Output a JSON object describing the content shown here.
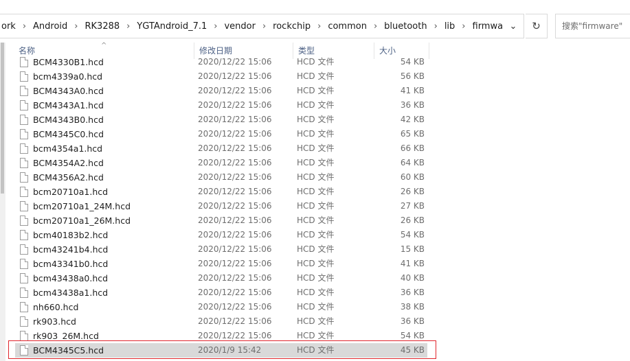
{
  "address": {
    "crumbs": [
      "ork",
      "Android",
      "RK3288",
      "YGTAndroid_7.1",
      "vendor",
      "rockchip",
      "common",
      "bluetooth",
      "lib",
      "firmware"
    ],
    "separator": "›",
    "dropdown_glyph": "⌄",
    "refresh_glyph": "↻"
  },
  "search": {
    "placeholder": "搜索\"firmware\""
  },
  "columns": {
    "name": "名称",
    "date": "修改日期",
    "type": "类型",
    "size": "大小",
    "sort_glyph": "^"
  },
  "files": [
    {
      "name": "BCM4330B1.hcd",
      "date": "2020/12/22 15:06",
      "type": "HCD 文件",
      "size": "54 KB"
    },
    {
      "name": "bcm4339a0.hcd",
      "date": "2020/12/22 15:06",
      "type": "HCD 文件",
      "size": "56 KB"
    },
    {
      "name": "BCM4343A0.hcd",
      "date": "2020/12/22 15:06",
      "type": "HCD 文件",
      "size": "41 KB"
    },
    {
      "name": "BCM4343A1.hcd",
      "date": "2020/12/22 15:06",
      "type": "HCD 文件",
      "size": "36 KB"
    },
    {
      "name": "BCM4343B0.hcd",
      "date": "2020/12/22 15:06",
      "type": "HCD 文件",
      "size": "42 KB"
    },
    {
      "name": "BCM4345C0.hcd",
      "date": "2020/12/22 15:06",
      "type": "HCD 文件",
      "size": "65 KB"
    },
    {
      "name": "bcm4354a1.hcd",
      "date": "2020/12/22 15:06",
      "type": "HCD 文件",
      "size": "66 KB"
    },
    {
      "name": "BCM4354A2.hcd",
      "date": "2020/12/22 15:06",
      "type": "HCD 文件",
      "size": "64 KB"
    },
    {
      "name": "BCM4356A2.hcd",
      "date": "2020/12/22 15:06",
      "type": "HCD 文件",
      "size": "60 KB"
    },
    {
      "name": "bcm20710a1.hcd",
      "date": "2020/12/22 15:06",
      "type": "HCD 文件",
      "size": "26 KB"
    },
    {
      "name": "bcm20710a1_24M.hcd",
      "date": "2020/12/22 15:06",
      "type": "HCD 文件",
      "size": "27 KB"
    },
    {
      "name": "bcm20710a1_26M.hcd",
      "date": "2020/12/22 15:06",
      "type": "HCD 文件",
      "size": "26 KB"
    },
    {
      "name": "bcm40183b2.hcd",
      "date": "2020/12/22 15:06",
      "type": "HCD 文件",
      "size": "54 KB"
    },
    {
      "name": "bcm43241b4.hcd",
      "date": "2020/12/22 15:06",
      "type": "HCD 文件",
      "size": "15 KB"
    },
    {
      "name": "bcm43341b0.hcd",
      "date": "2020/12/22 15:06",
      "type": "HCD 文件",
      "size": "41 KB"
    },
    {
      "name": "bcm43438a0.hcd",
      "date": "2020/12/22 15:06",
      "type": "HCD 文件",
      "size": "40 KB"
    },
    {
      "name": "bcm43438a1.hcd",
      "date": "2020/12/22 15:06",
      "type": "HCD 文件",
      "size": "36 KB"
    },
    {
      "name": "nh660.hcd",
      "date": "2020/12/22 15:06",
      "type": "HCD 文件",
      "size": "38 KB"
    },
    {
      "name": "rk903.hcd",
      "date": "2020/12/22 15:06",
      "type": "HCD 文件",
      "size": "36 KB"
    },
    {
      "name": "rk903_26M.hcd",
      "date": "2020/12/22 15:06",
      "type": "HCD 文件",
      "size": "54 KB"
    },
    {
      "name": "BCM4345C5.hcd",
      "date": "2020/1/9 15:42",
      "type": "HCD 文件",
      "size": "45 KB",
      "selected": true
    }
  ],
  "colors": {
    "selection_bg": "#d9d9d9",
    "annotation_frame": "#e0242b",
    "header_text": "#4d6185"
  }
}
